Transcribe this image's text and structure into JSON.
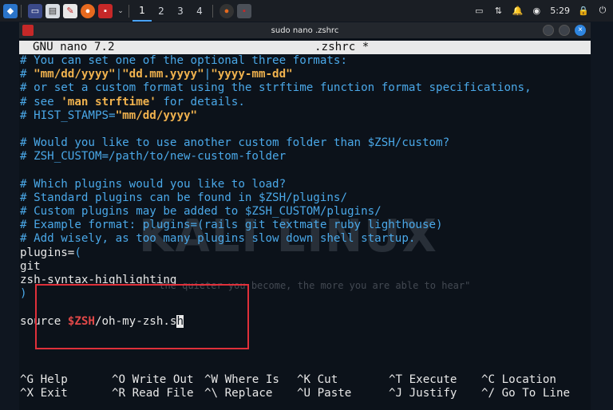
{
  "panel": {
    "workspaces": [
      "1",
      "2",
      "3",
      "4"
    ],
    "clock": "5:29"
  },
  "window": {
    "title": "sudo nano .zshrc"
  },
  "nano": {
    "version": "GNU nano 7.2",
    "filename": ".zshrc *"
  },
  "lines": [
    [
      [
        "c",
        "# You can set one of the optional three formats:"
      ]
    ],
    [
      [
        "c",
        "# "
      ],
      [
        "y",
        "\"mm/dd/yyyy\""
      ],
      [
        "c",
        "|"
      ],
      [
        "y",
        "\"dd.mm.yyyy\""
      ],
      [
        "c",
        "|"
      ],
      [
        "y",
        "\"yyyy-mm-dd\""
      ]
    ],
    [
      [
        "c",
        "# or set a custom format using the strftime function format specifications,"
      ]
    ],
    [
      [
        "c",
        "# see "
      ],
      [
        "y",
        "'man strftime'"
      ],
      [
        "c",
        " for details."
      ]
    ],
    [
      [
        "c",
        "# HIST_STAMPS="
      ],
      [
        "y",
        "\"mm/dd/yyyy\""
      ]
    ],
    [
      [
        "c",
        ""
      ]
    ],
    [
      [
        "c",
        "# Would you like to use another custom folder than $ZSH/custom?"
      ]
    ],
    [
      [
        "c",
        "# ZSH_CUSTOM=/path/to/new-custom-folder"
      ]
    ],
    [
      [
        "c",
        ""
      ]
    ],
    [
      [
        "c",
        "# Which plugins would you like to load?"
      ]
    ],
    [
      [
        "c",
        "# Standard plugins can be found in $ZSH/plugins/"
      ]
    ],
    [
      [
        "c",
        "# Custom plugins may be added to $ZSH_CUSTOM/plugins/"
      ]
    ],
    [
      [
        "c",
        "# Example format: plugins=(rails git textmate ruby lighthouse)"
      ]
    ],
    [
      [
        "c",
        "# Add wisely, as too many plugins slow down shell startup."
      ]
    ],
    [
      [
        "w",
        "plugins="
      ],
      [
        "c",
        "("
      ]
    ],
    [
      [
        "w",
        "git"
      ]
    ],
    [
      [
        "w",
        "zsh-syntax-highlighting"
      ]
    ],
    [
      [
        "c",
        ")"
      ]
    ],
    [
      [
        "c",
        ""
      ]
    ],
    [
      [
        "w",
        "source "
      ],
      [
        "r",
        "$ZSH"
      ],
      [
        "w",
        "/oh-my-zsh.s"
      ],
      [
        "cursor",
        "h"
      ]
    ]
  ],
  "watermark": {
    "logo_text": "KALI LINUX",
    "quote": "\"the quieter you become, the more you are able to hear\""
  },
  "shortcuts": [
    {
      "key": "^G",
      "label": "Help"
    },
    {
      "key": "^O",
      "label": "Write Out"
    },
    {
      "key": "^W",
      "label": "Where Is"
    },
    {
      "key": "^K",
      "label": "Cut"
    },
    {
      "key": "^T",
      "label": "Execute"
    },
    {
      "key": "^C",
      "label": "Location"
    },
    {
      "key": "^X",
      "label": "Exit"
    },
    {
      "key": "^R",
      "label": "Read File"
    },
    {
      "key": "^\\",
      "label": "Replace"
    },
    {
      "key": "^U",
      "label": "Paste"
    },
    {
      "key": "^J",
      "label": "Justify"
    },
    {
      "key": "^/",
      "label": "Go To Line"
    }
  ],
  "colors": {
    "comment": "#4aa8e8",
    "string": "#f0b24e",
    "variable": "#e04848",
    "highlight_box": "#e0303a"
  }
}
